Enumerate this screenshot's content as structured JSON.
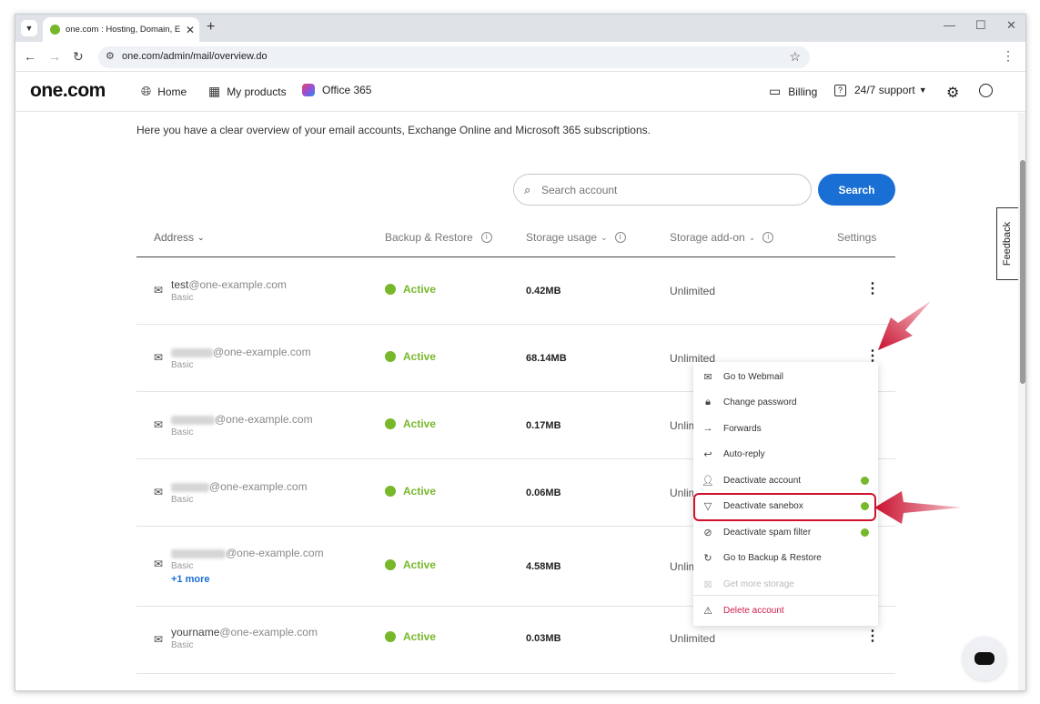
{
  "browser": {
    "tab_title": "one.com : Hosting, Domain, Em",
    "url": "one.com/admin/mail/overview.do",
    "new_tab": "+",
    "tab_close": "✕",
    "minimize": "—",
    "maximize": "☐",
    "close": "✕"
  },
  "header": {
    "logo": "one.com",
    "nav": [
      {
        "label": "Home",
        "icon": "globe-icon"
      },
      {
        "label": "My products",
        "icon": "grid-icon"
      },
      {
        "label": "Office 365",
        "icon": "office-365-icon"
      }
    ],
    "billing": "Billing",
    "support": "24/7 support"
  },
  "page": {
    "intro": "Here you have a clear overview of your email accounts, Exchange Online and Microsoft 365 subscriptions.",
    "search_placeholder": "Search account",
    "search_button": "Search"
  },
  "table": {
    "headers": {
      "address": "Address",
      "backup": "Backup & Restore",
      "storage": "Storage usage",
      "addon": "Storage add-on",
      "settings": "Settings"
    },
    "rows": [
      {
        "user": "test",
        "domain": "@one-example.com",
        "plan": "Basic",
        "status": "Active",
        "usage": "0.42MB",
        "addon": "Unlimited"
      },
      {
        "user": "",
        "domain": "@one-example.com",
        "plan": "Basic",
        "status": "Active",
        "usage": "68.14MB",
        "addon": "Unlimited"
      },
      {
        "user": "",
        "domain": "@one-example.com",
        "plan": "Basic",
        "status": "Active",
        "usage": "0.17MB",
        "addon": "Unlim"
      },
      {
        "user": "",
        "domain": "@one-example.com",
        "plan": "Basic",
        "status": "Active",
        "usage": "0.06MB",
        "addon": "Unlim"
      },
      {
        "user": "",
        "domain": "@one-example.com",
        "plan": "Basic",
        "more": "+1 more",
        "status": "Active",
        "usage": "4.58MB",
        "addon": "Unlim"
      },
      {
        "user": "yourname",
        "domain": "@one-example.com",
        "plan": "Basic",
        "status": "Active",
        "usage": "0.03MB",
        "addon": "Unlimited"
      }
    ]
  },
  "dropdown": {
    "items": [
      {
        "label": "Go to Webmail",
        "icon": "mail-icon"
      },
      {
        "label": "Change password",
        "icon": "lock-icon"
      },
      {
        "label": "Forwards",
        "icon": "arrow-right-icon"
      },
      {
        "label": "Auto-reply",
        "icon": "reply-icon"
      },
      {
        "label": "Deactivate account",
        "icon": "user-icon"
      },
      {
        "label": "Deactivate sanebox",
        "icon": "filter-icon"
      },
      {
        "label": "Deactivate spam filter",
        "icon": "block-icon"
      },
      {
        "label": "Go to Backup & Restore",
        "icon": "restore-icon"
      },
      {
        "label": "Get more storage",
        "icon": "storage-icon"
      },
      {
        "label": "Delete account",
        "icon": "delete-user-icon"
      }
    ]
  },
  "feedback": "Feedback",
  "colors": {
    "accent": "#1a6fd4",
    "active": "#76b82a",
    "danger": "#d11d4c",
    "highlight": "#d0112b"
  }
}
